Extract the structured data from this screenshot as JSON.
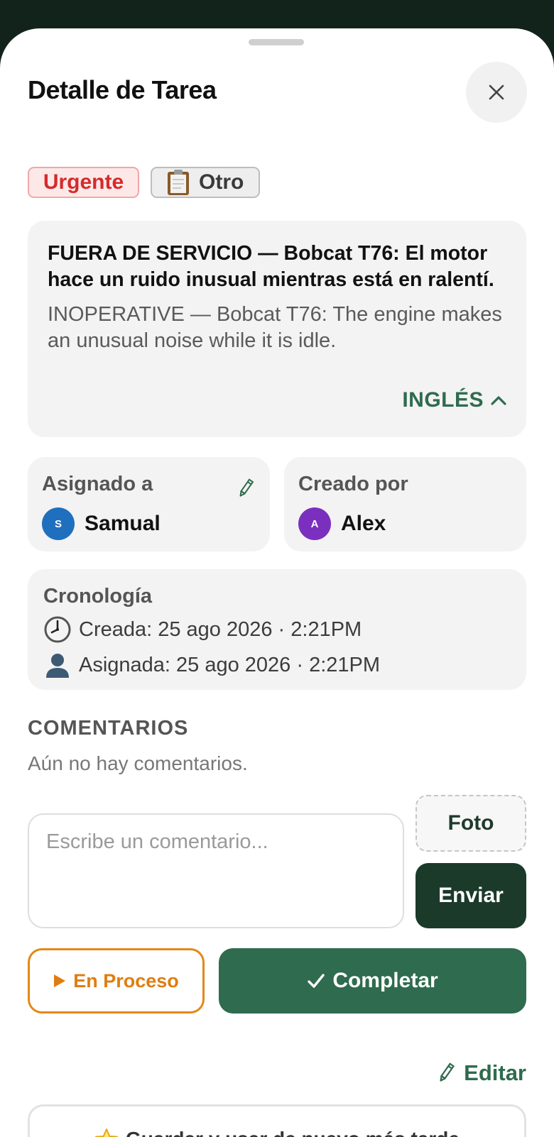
{
  "header": {
    "title": "Detalle de Tarea"
  },
  "badges": {
    "priority": "Urgente",
    "category_icon": "clipboard-icon",
    "category": "Otro"
  },
  "description": {
    "primary": "FUERA DE SERVICIO — Bobcat T76: El motor hace un ruido inusual mientras está en ralentí.",
    "secondary": "INOPERATIVE — Bobcat T76: The engine makes an unusual noise while it is idle.",
    "language_toggle": "INGLÉS"
  },
  "assignment": {
    "assigned_label": "Asignado a",
    "assigned_name": "Samual",
    "assigned_initial": "S",
    "assigned_color": "#1f6fbf",
    "created_label": "Creado por",
    "created_name": "Alex",
    "created_initial": "A",
    "created_color": "#7b2fbf"
  },
  "timeline": {
    "title": "Cronología",
    "created": "Creada: 25 ago 2026 · 2:21PM",
    "assigned": "Asignada: 25 ago 2026 · 2:21PM"
  },
  "comments": {
    "title": "COMENTARIOS",
    "empty": "Aún no hay comentarios.",
    "placeholder": "Escribe un comentario...",
    "value": "",
    "photo_label": "Foto",
    "send_label": "Enviar"
  },
  "actions": {
    "in_progress_label": "En Proceso",
    "complete_label": "Completar",
    "edit_label": "Editar",
    "save_later_label": "Guardar y usar de nuevo más tarde"
  },
  "colors": {
    "brand": "#2f6b4e",
    "dark_brand": "#1b3a2a",
    "urgent": "#d42b2b",
    "in_progress": "#e07d10"
  }
}
